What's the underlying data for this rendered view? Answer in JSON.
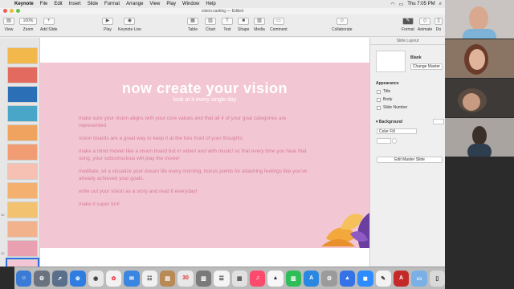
{
  "menubar": {
    "app": "Keynote",
    "items": [
      "File",
      "Edit",
      "Insert",
      "Slide",
      "Format",
      "Arrange",
      "View",
      "Play",
      "Window",
      "Help"
    ],
    "clock": "Thu 7:05 PM"
  },
  "window": {
    "title": "vision.casting — Edited",
    "toolbar": {
      "view": "View",
      "zoom_value": "100%",
      "zoom": "Zoom",
      "add_slide": "Add Slide",
      "play": "Play",
      "keynote_live": "Keynote Live",
      "table": "Table",
      "chart": "Chart",
      "text": "Text",
      "shape": "Shape",
      "media": "Media",
      "comment": "Comment",
      "collaborate": "Collaborate",
      "format": "Format",
      "animate": "Animate",
      "document": "Do"
    }
  },
  "navigator": {
    "slide_numbers": [
      "",
      "",
      "",
      "",
      "",
      "",
      "",
      "",
      "10",
      "",
      "12",
      "13"
    ],
    "thumb_colors": [
      "#f2b84b",
      "#e36a5f",
      "#2b6fb6",
      "#4aa6c9",
      "#f0a35e",
      "#f29c73",
      "#f6c1b3",
      "#f4b06e",
      "#f2c270",
      "#f2b38c",
      "#e9a0b0",
      "#f2c7d3"
    ]
  },
  "slide": {
    "title": "now create your vision",
    "subtitle": "look at it every single day",
    "bullets": [
      "make sure your vision aligns with your core values and that all 4 of your goal categories are represented",
      "vision boards are a great way to keep it at the fore front of your thoughts",
      "make a mind movie! like a vision board but in video! and with music! so that every time you hear that song, your subconscious will play the movie!",
      "meditate, sit a visualize your dream life every morning, bonus points for attaching feelings like you've already achieved your goals.",
      "write out your vision as a story and read it everyday!",
      "make it super fun!"
    ]
  },
  "inspector": {
    "tab": "Slide Layout",
    "layout_name": "Blank",
    "change_master": "Change Master",
    "appearance": "Appearance",
    "title": "Title",
    "body": "Body",
    "slide_number": "Slide Number",
    "background": "Background",
    "fill_type": "Color Fill",
    "edit_master": "Edit Master Slide"
  },
  "colors": {
    "slide_bg": "#f2c7d3",
    "bullet_text": "#d77a97",
    "title_text": "#ffffff"
  }
}
